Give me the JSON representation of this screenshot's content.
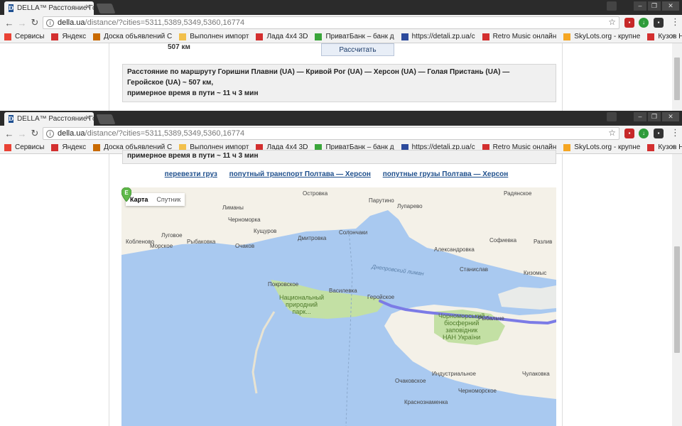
{
  "browser": {
    "tab_title": "DELLA™ Расстояние Гор",
    "url_host": "della.ua",
    "url_path": "/distance/?cities=5311,5389,5349,5360,16774",
    "bookmarks": [
      {
        "label": "Сервисы",
        "icon": "apps-grid-icon",
        "color": "#e94235"
      },
      {
        "label": "Яндекс",
        "icon": "yandex-icon",
        "color": "#d32f2f"
      },
      {
        "label": "Доска объявлений С",
        "icon": "olx-icon",
        "color": "#c96a00"
      },
      {
        "label": "Выполнен импорт",
        "icon": "folder-icon",
        "color": "#f2c04c"
      },
      {
        "label": "Лада 4x4 3D",
        "icon": "d-logo-icon",
        "color": "#d32f2f"
      },
      {
        "label": "ПриватБанк – банк д",
        "icon": "privatbank-icon",
        "color": "#3aa53a"
      },
      {
        "label": "https://detali.zp.ua/c",
        "icon": "gear-icon",
        "color": "#2c4a9c"
      },
      {
        "label": "Retro Music онлайн",
        "icon": "tv-icon",
        "color": "#d32f2f"
      },
      {
        "label": "SkyLots.org - крупне",
        "icon": "skylots-icon",
        "color": "#f5a623"
      },
      {
        "label": "Кузов Нива ВАЗ 212",
        "icon": "4x4-icon",
        "color": "#d32f2f"
      }
    ]
  },
  "top": {
    "distance_short": "507 км",
    "calc_button": "Рассчитать",
    "result_line1": "Расстояние по маршруту Горишни Плавни (UA) — Кривой Рог (UA) — Херсон (UA) — Голая Пристань (UA) —",
    "result_line2": "Геройское (UA) ~ 507 км,",
    "result_line3": "примерное время в пути ~ 11 ч 3 мин"
  },
  "links": {
    "cargo": "перевезти груз",
    "transport": "попутный транспорт Полтава — Херсон",
    "loads": "попутные грузы Полтава — Херсон"
  },
  "map": {
    "tab_map": "Карта",
    "tab_satellite": "Спутник",
    "marker_letter": "E",
    "places": [
      {
        "name": "Радянское",
        "cls": ""
      },
      {
        "name": "Островка",
        "cls": ""
      },
      {
        "name": "Паpутино",
        "cls": ""
      },
      {
        "name": "Лупарево",
        "cls": ""
      },
      {
        "name": "Лиманы",
        "cls": ""
      },
      {
        "name": "Черноморка",
        "cls": ""
      },
      {
        "name": "Кобленово",
        "cls": ""
      },
      {
        "name": "Морское",
        "cls": ""
      },
      {
        "name": "Луговое",
        "cls": ""
      },
      {
        "name": "Рыбаковка",
        "cls": ""
      },
      {
        "name": "Кущуров",
        "cls": ""
      },
      {
        "name": "Дмитровка",
        "cls": ""
      },
      {
        "name": "Солончаки",
        "cls": ""
      },
      {
        "name": "Очаков",
        "cls": ""
      },
      {
        "name": "Александровка",
        "cls": ""
      },
      {
        "name": "Софиевка",
        "cls": ""
      },
      {
        "name": "Разлив",
        "cls": ""
      },
      {
        "name": "Станислав",
        "cls": ""
      },
      {
        "name": "Кизомыс",
        "cls": ""
      },
      {
        "name": "Днепровский лиман",
        "cls": "water"
      },
      {
        "name": "Покровское",
        "cls": ""
      },
      {
        "name": "Василевка",
        "cls": ""
      },
      {
        "name": "Геройское",
        "cls": ""
      },
      {
        "name": "Рыбальче",
        "cls": ""
      },
      {
        "name": "Индустриальное",
        "cls": ""
      },
      {
        "name": "Очаковское",
        "cls": ""
      },
      {
        "name": "Черноморское",
        "cls": ""
      },
      {
        "name": "Чулаковка",
        "cls": ""
      },
      {
        "name": "Краснознаменка",
        "cls": ""
      }
    ],
    "park1_l1": "Национальный",
    "park1_l2": "природний",
    "park1_l3": "парк...",
    "park2_l1": "Чорноморський",
    "park2_l2": "біосферний",
    "park2_l3": "заповідник",
    "park2_l4": "НАН України"
  },
  "colors": {
    "water": "#a9c9f0",
    "land": "#f4f1e8",
    "park": "#c3e0a4",
    "route": "#7b7be6",
    "marker": "#5fb94a"
  }
}
